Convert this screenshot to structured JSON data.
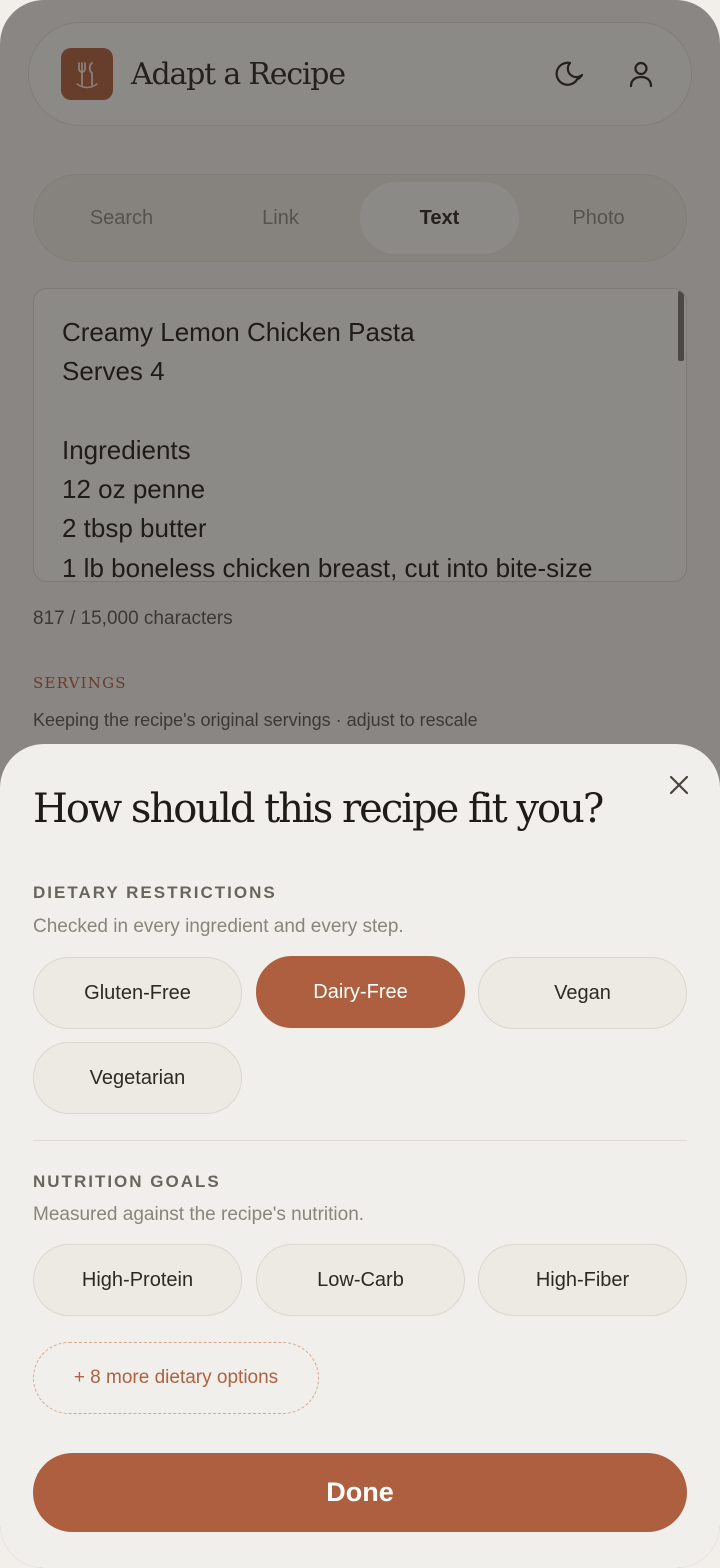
{
  "header": {
    "title": "Adapt a Recipe",
    "logo_icon": "fork-knife-icon",
    "theme_icon": "moon-icon",
    "profile_icon": "user-icon"
  },
  "tabs": [
    {
      "label": "Search",
      "active": false
    },
    {
      "label": "Link",
      "active": false
    },
    {
      "label": "Text",
      "active": true
    },
    {
      "label": "Photo",
      "active": false
    }
  ],
  "recipe_text": {
    "lines": [
      "Creamy Lemon Chicken Pasta",
      "Serves 4",
      "",
      "Ingredients",
      "12 oz penne",
      "2 tbsp butter",
      "1 lb boneless chicken breast, cut into bite-size"
    ],
    "char_count": "817 / 15,000 characters"
  },
  "servings": {
    "label": "SERVINGS",
    "subtext": "Keeping the recipe's original servings · adjust to rescale"
  },
  "sheet": {
    "title": "How should this recipe fit you?",
    "close_icon": "close-icon",
    "dietary": {
      "label": "DIETARY RESTRICTIONS",
      "subtext": "Checked in every ingredient and every step.",
      "options": [
        {
          "label": "Gluten-Free",
          "selected": false
        },
        {
          "label": "Dairy-Free",
          "selected": true
        },
        {
          "label": "Vegan",
          "selected": false
        },
        {
          "label": "Vegetarian",
          "selected": false
        }
      ]
    },
    "nutrition": {
      "label": "NUTRITION GOALS",
      "subtext": "Measured against the recipe's nutrition.",
      "options": [
        {
          "label": "High-Protein",
          "selected": false
        },
        {
          "label": "Low-Carb",
          "selected": false
        },
        {
          "label": "High-Fiber",
          "selected": false
        }
      ]
    },
    "more_label": "+ 8 more dietary options",
    "done_label": "Done"
  },
  "colors": {
    "accent": "#ad5f3f",
    "sheet_bg": "#f1efeb"
  }
}
